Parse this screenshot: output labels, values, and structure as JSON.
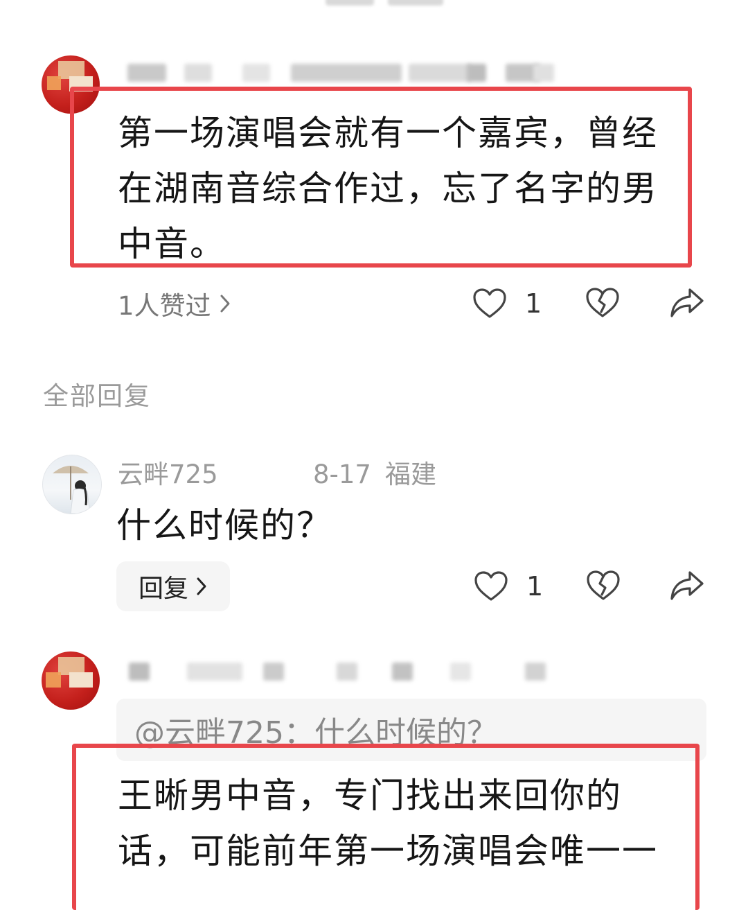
{
  "main_comment": {
    "text_lines": [
      "第一场演唱会就有一个嘉宾，曾经",
      "在湖南音综合作过，忘了名字的男",
      "中音。"
    ],
    "liked_by": "1人赞过",
    "like_count": "1"
  },
  "section": {
    "all_replies_label": "全部回复"
  },
  "reply_1": {
    "username": "云畔725",
    "date": "8-17",
    "location": "福建",
    "text": "什么时候的？",
    "reply_button": "回复",
    "like_count": "1"
  },
  "reply_2": {
    "quote": "@云畔725：什么时候的？",
    "text_lines": [
      "王晰男中音，专门找出来回你的",
      "话，可能前年第一场演唱会唯一一"
    ]
  },
  "colors": {
    "highlight_border": "#e8464b",
    "avatar_red": "#c4201c",
    "meta_gray": "#9a9a9a"
  },
  "icons": {
    "like": "heart-icon",
    "dislike": "broken-heart-icon",
    "share": "share-arrow-icon",
    "chevron": "chevron-right-icon"
  }
}
